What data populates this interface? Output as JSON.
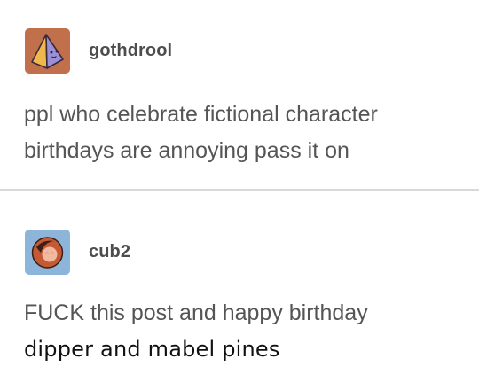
{
  "posts": [
    {
      "username": "gothdrool",
      "avatar_icon": "pyramid-icon",
      "lines": [
        "ppl who celebrate fictional character",
        "birthdays are annoying pass it on"
      ]
    },
    {
      "username": "cub2",
      "avatar_icon": "creature-face-icon",
      "lines": [
        "FUCK this post and happy birthday"
      ],
      "caption": "dipper and mabel pines"
    }
  ],
  "colors": {
    "avatar1_bg": "#c1704c",
    "avatar2_bg": "#8db4d9",
    "username": "#4d4d4d",
    "body_text": "#555555",
    "caption_text": "#111111",
    "divider": "#d9d9d9"
  }
}
